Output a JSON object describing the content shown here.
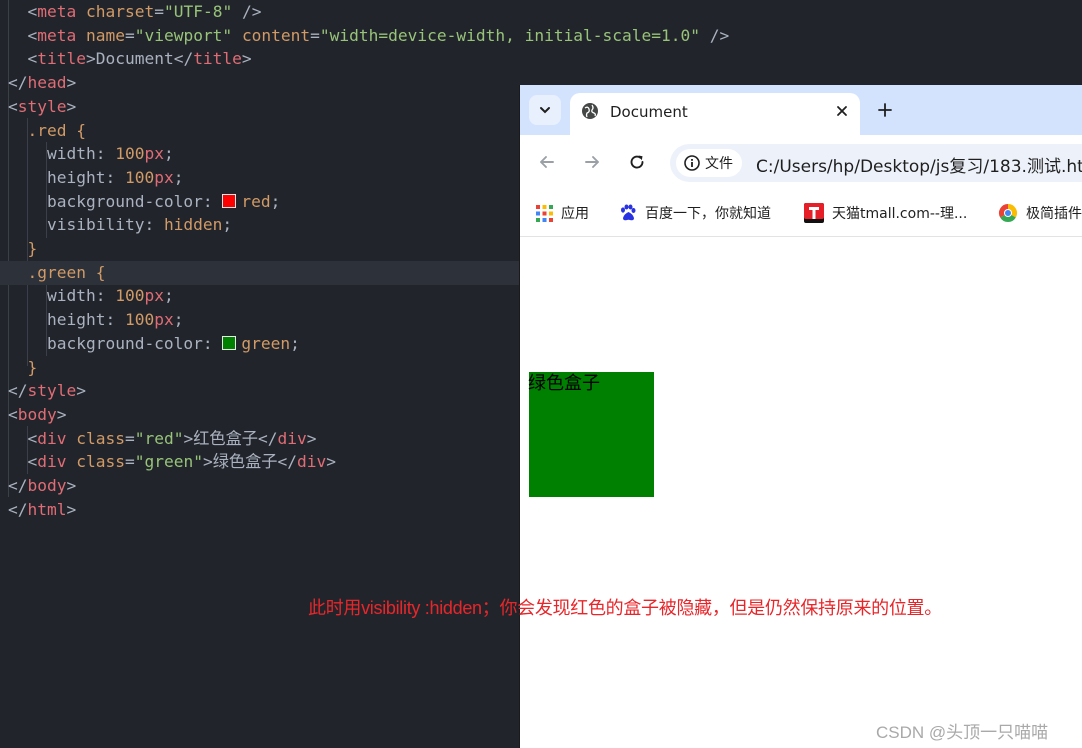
{
  "editor": {
    "lines": [
      {
        "parts": [
          [
            "pun",
            "  "
          ],
          [
            "pun",
            "<"
          ],
          [
            "tag",
            "meta"
          ],
          [
            "pun",
            " "
          ],
          [
            "attr",
            "charset"
          ],
          [
            "pun",
            "="
          ],
          [
            "str",
            "\"UTF-8\""
          ],
          [
            "pun",
            " />"
          ]
        ]
      },
      {
        "parts": [
          [
            "pun",
            "  "
          ],
          [
            "pun",
            "<"
          ],
          [
            "tag",
            "meta"
          ],
          [
            "pun",
            " "
          ],
          [
            "attr",
            "name"
          ],
          [
            "pun",
            "="
          ],
          [
            "str",
            "\"viewport\""
          ],
          [
            "pun",
            " "
          ],
          [
            "attr",
            "content"
          ],
          [
            "pun",
            "="
          ],
          [
            "str",
            "\"width=device-width, initial-scale=1.0\""
          ],
          [
            "pun",
            " />"
          ]
        ]
      },
      {
        "parts": [
          [
            "pun",
            "  "
          ],
          [
            "pun",
            "<"
          ],
          [
            "tag",
            "title"
          ],
          [
            "pun",
            ">Document</"
          ],
          [
            "tag",
            "title"
          ],
          [
            "pun",
            ">"
          ]
        ]
      },
      {
        "parts": [
          [
            "pun",
            "</"
          ],
          [
            "tag",
            "head"
          ],
          [
            "pun",
            ">"
          ]
        ]
      },
      {
        "parts": [
          [
            "pun",
            "<"
          ],
          [
            "tag",
            "style"
          ],
          [
            "pun",
            ">"
          ]
        ]
      },
      {
        "parts": [
          [
            "pun",
            "  "
          ],
          [
            "sel",
            ".red"
          ],
          [
            "pun",
            " "
          ],
          [
            "sel",
            "{"
          ]
        ]
      },
      {
        "parts": [
          [
            "pun",
            "    width: "
          ],
          [
            "num",
            "100"
          ],
          [
            "unit",
            "px"
          ],
          [
            "pun",
            ";"
          ]
        ]
      },
      {
        "parts": [
          [
            "pun",
            "    height: "
          ],
          [
            "num",
            "100"
          ],
          [
            "unit",
            "px"
          ],
          [
            "pun",
            ";"
          ]
        ]
      },
      {
        "parts": [
          [
            "pun",
            "    background-color: "
          ],
          [
            "swatch",
            "#ff0000"
          ],
          [
            "num",
            "red"
          ],
          [
            "pun",
            ";"
          ]
        ]
      },
      {
        "parts": [
          [
            "pun",
            "    visibility: "
          ],
          [
            "num",
            "hidden"
          ],
          [
            "pun",
            ";"
          ]
        ]
      },
      {
        "parts": [
          [
            "pun",
            "  "
          ],
          [
            "sel",
            "}"
          ]
        ]
      },
      {
        "parts": [
          [
            "pun",
            "  "
          ],
          [
            "sel",
            ".green"
          ],
          [
            "pun",
            " "
          ],
          [
            "sel",
            "{"
          ]
        ]
      },
      {
        "parts": [
          [
            "pun",
            "    width: "
          ],
          [
            "num",
            "100"
          ],
          [
            "unit",
            "px"
          ],
          [
            "pun",
            ";"
          ]
        ]
      },
      {
        "parts": [
          [
            "pun",
            "    height: "
          ],
          [
            "num",
            "100"
          ],
          [
            "unit",
            "px"
          ],
          [
            "pun",
            ";"
          ]
        ]
      },
      {
        "parts": [
          [
            "pun",
            "    background-color: "
          ],
          [
            "swatch",
            "#008000"
          ],
          [
            "num",
            "green"
          ],
          [
            "pun",
            ";"
          ]
        ]
      },
      {
        "parts": [
          [
            "pun",
            "  "
          ],
          [
            "sel",
            "}"
          ]
        ]
      },
      {
        "parts": [
          [
            "pun",
            "</"
          ],
          [
            "tag",
            "style"
          ],
          [
            "pun",
            ">"
          ]
        ]
      },
      {
        "parts": [
          [
            "pun",
            "<"
          ],
          [
            "tag",
            "body"
          ],
          [
            "pun",
            ">"
          ]
        ]
      },
      {
        "parts": [
          [
            "pun",
            "  <"
          ],
          [
            "tag",
            "div"
          ],
          [
            "pun",
            " "
          ],
          [
            "attr",
            "class"
          ],
          [
            "pun",
            "="
          ],
          [
            "str",
            "\"red\""
          ],
          [
            "pun",
            ">红色盒子</"
          ],
          [
            "tag",
            "div"
          ],
          [
            "pun",
            ">"
          ]
        ]
      },
      {
        "parts": [
          [
            "pun",
            "  <"
          ],
          [
            "tag",
            "div"
          ],
          [
            "pun",
            " "
          ],
          [
            "attr",
            "class"
          ],
          [
            "pun",
            "="
          ],
          [
            "str",
            "\"green\""
          ],
          [
            "pun",
            ">绿色盒子</"
          ],
          [
            "tag",
            "div"
          ],
          [
            "pun",
            ">"
          ]
        ]
      },
      {
        "parts": [
          [
            "pun",
            "</"
          ],
          [
            "tag",
            "body"
          ],
          [
            "pun",
            ">"
          ]
        ]
      },
      {
        "parts": [
          [
            "pun",
            "</"
          ],
          [
            "tag",
            "html"
          ],
          [
            "pun",
            ">"
          ]
        ]
      }
    ]
  },
  "browser": {
    "tab_title": "Document",
    "site_info_label": "文件",
    "url": "C:/Users/hp/Desktop/js复习/183.测试.ht",
    "bookmarks": [
      {
        "label": "应用",
        "icon": "apps-grid-icon"
      },
      {
        "label": "百度一下，你就知道",
        "icon": "baidu-paw-icon"
      },
      {
        "label": "天猫tmall.com--理...",
        "icon": "tmall-icon"
      },
      {
        "label": "极简插件",
        "icon": "chrome-icon"
      }
    ],
    "content": {
      "green_box_text": "绿色盒子"
    }
  },
  "annotation": "此时用visibility :hidden；你会发现红色的盒子被隐藏，但是仍然保持原来的位置。",
  "watermark": "CSDN @头顶一只喵喵",
  "colors": {
    "editor_bg": "#21252b",
    "tabstrip_bg": "#d3e3fd",
    "annotation": "#e8262a",
    "green_box": "#008000"
  }
}
